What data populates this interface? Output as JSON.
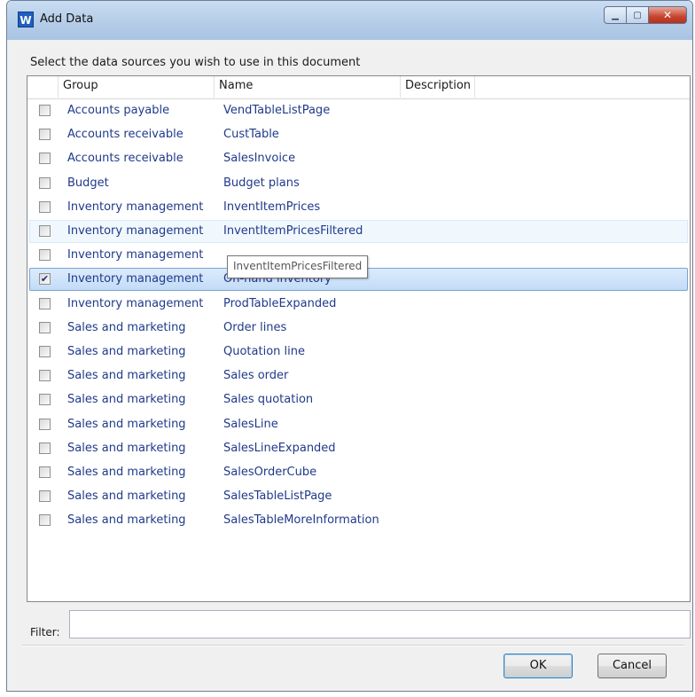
{
  "window": {
    "title": "Add Data",
    "icon_letter": "W",
    "minimize_symbol": "▁",
    "maximize_symbol": "▢",
    "close_symbol": "✕"
  },
  "instruction": "Select the data sources you wish to use in this document",
  "columns": [
    "Group",
    "Name",
    "Description"
  ],
  "rows": [
    {
      "group": "Accounts payable",
      "name": "VendTableListPage",
      "checked": false
    },
    {
      "group": "Accounts receivable",
      "name": "CustTable",
      "checked": false
    },
    {
      "group": "Accounts receivable",
      "name": "SalesInvoice",
      "checked": false
    },
    {
      "group": "Budget",
      "name": "Budget plans",
      "checked": false
    },
    {
      "group": "Inventory management",
      "name": "InventItemPrices",
      "checked": false
    },
    {
      "group": "Inventory management",
      "name": "InventItemPricesFiltered",
      "checked": false,
      "state": "hover"
    },
    {
      "group": "Inventory management",
      "name": "",
      "checked": false
    },
    {
      "group": "Inventory management",
      "name": "On-hand inventory",
      "checked": true,
      "state": "selected"
    },
    {
      "group": "Inventory management",
      "name": "ProdTableExpanded",
      "checked": false
    },
    {
      "group": "Sales and marketing",
      "name": "Order lines",
      "checked": false
    },
    {
      "group": "Sales and marketing",
      "name": "Quotation line",
      "checked": false
    },
    {
      "group": "Sales and marketing",
      "name": "Sales order",
      "checked": false
    },
    {
      "group": "Sales and marketing",
      "name": "Sales quotation",
      "checked": false
    },
    {
      "group": "Sales and marketing",
      "name": "SalesLine",
      "checked": false
    },
    {
      "group": "Sales and marketing",
      "name": "SalesLineExpanded",
      "checked": false
    },
    {
      "group": "Sales and marketing",
      "name": "SalesOrderCube",
      "checked": false
    },
    {
      "group": "Sales and marketing",
      "name": "SalesTableListPage",
      "checked": false
    },
    {
      "group": "Sales and marketing",
      "name": "SalesTableMoreInformation",
      "checked": false
    }
  ],
  "tooltip": "InventItemPricesFiltered",
  "filter": {
    "label": "Filter:",
    "value": ""
  },
  "buttons": {
    "ok": "OK",
    "cancel": "Cancel"
  },
  "colors": {
    "selected_row": "#c2dcf7",
    "hover_row": "#f1f8fd",
    "link_text": "#1f3a8a"
  }
}
